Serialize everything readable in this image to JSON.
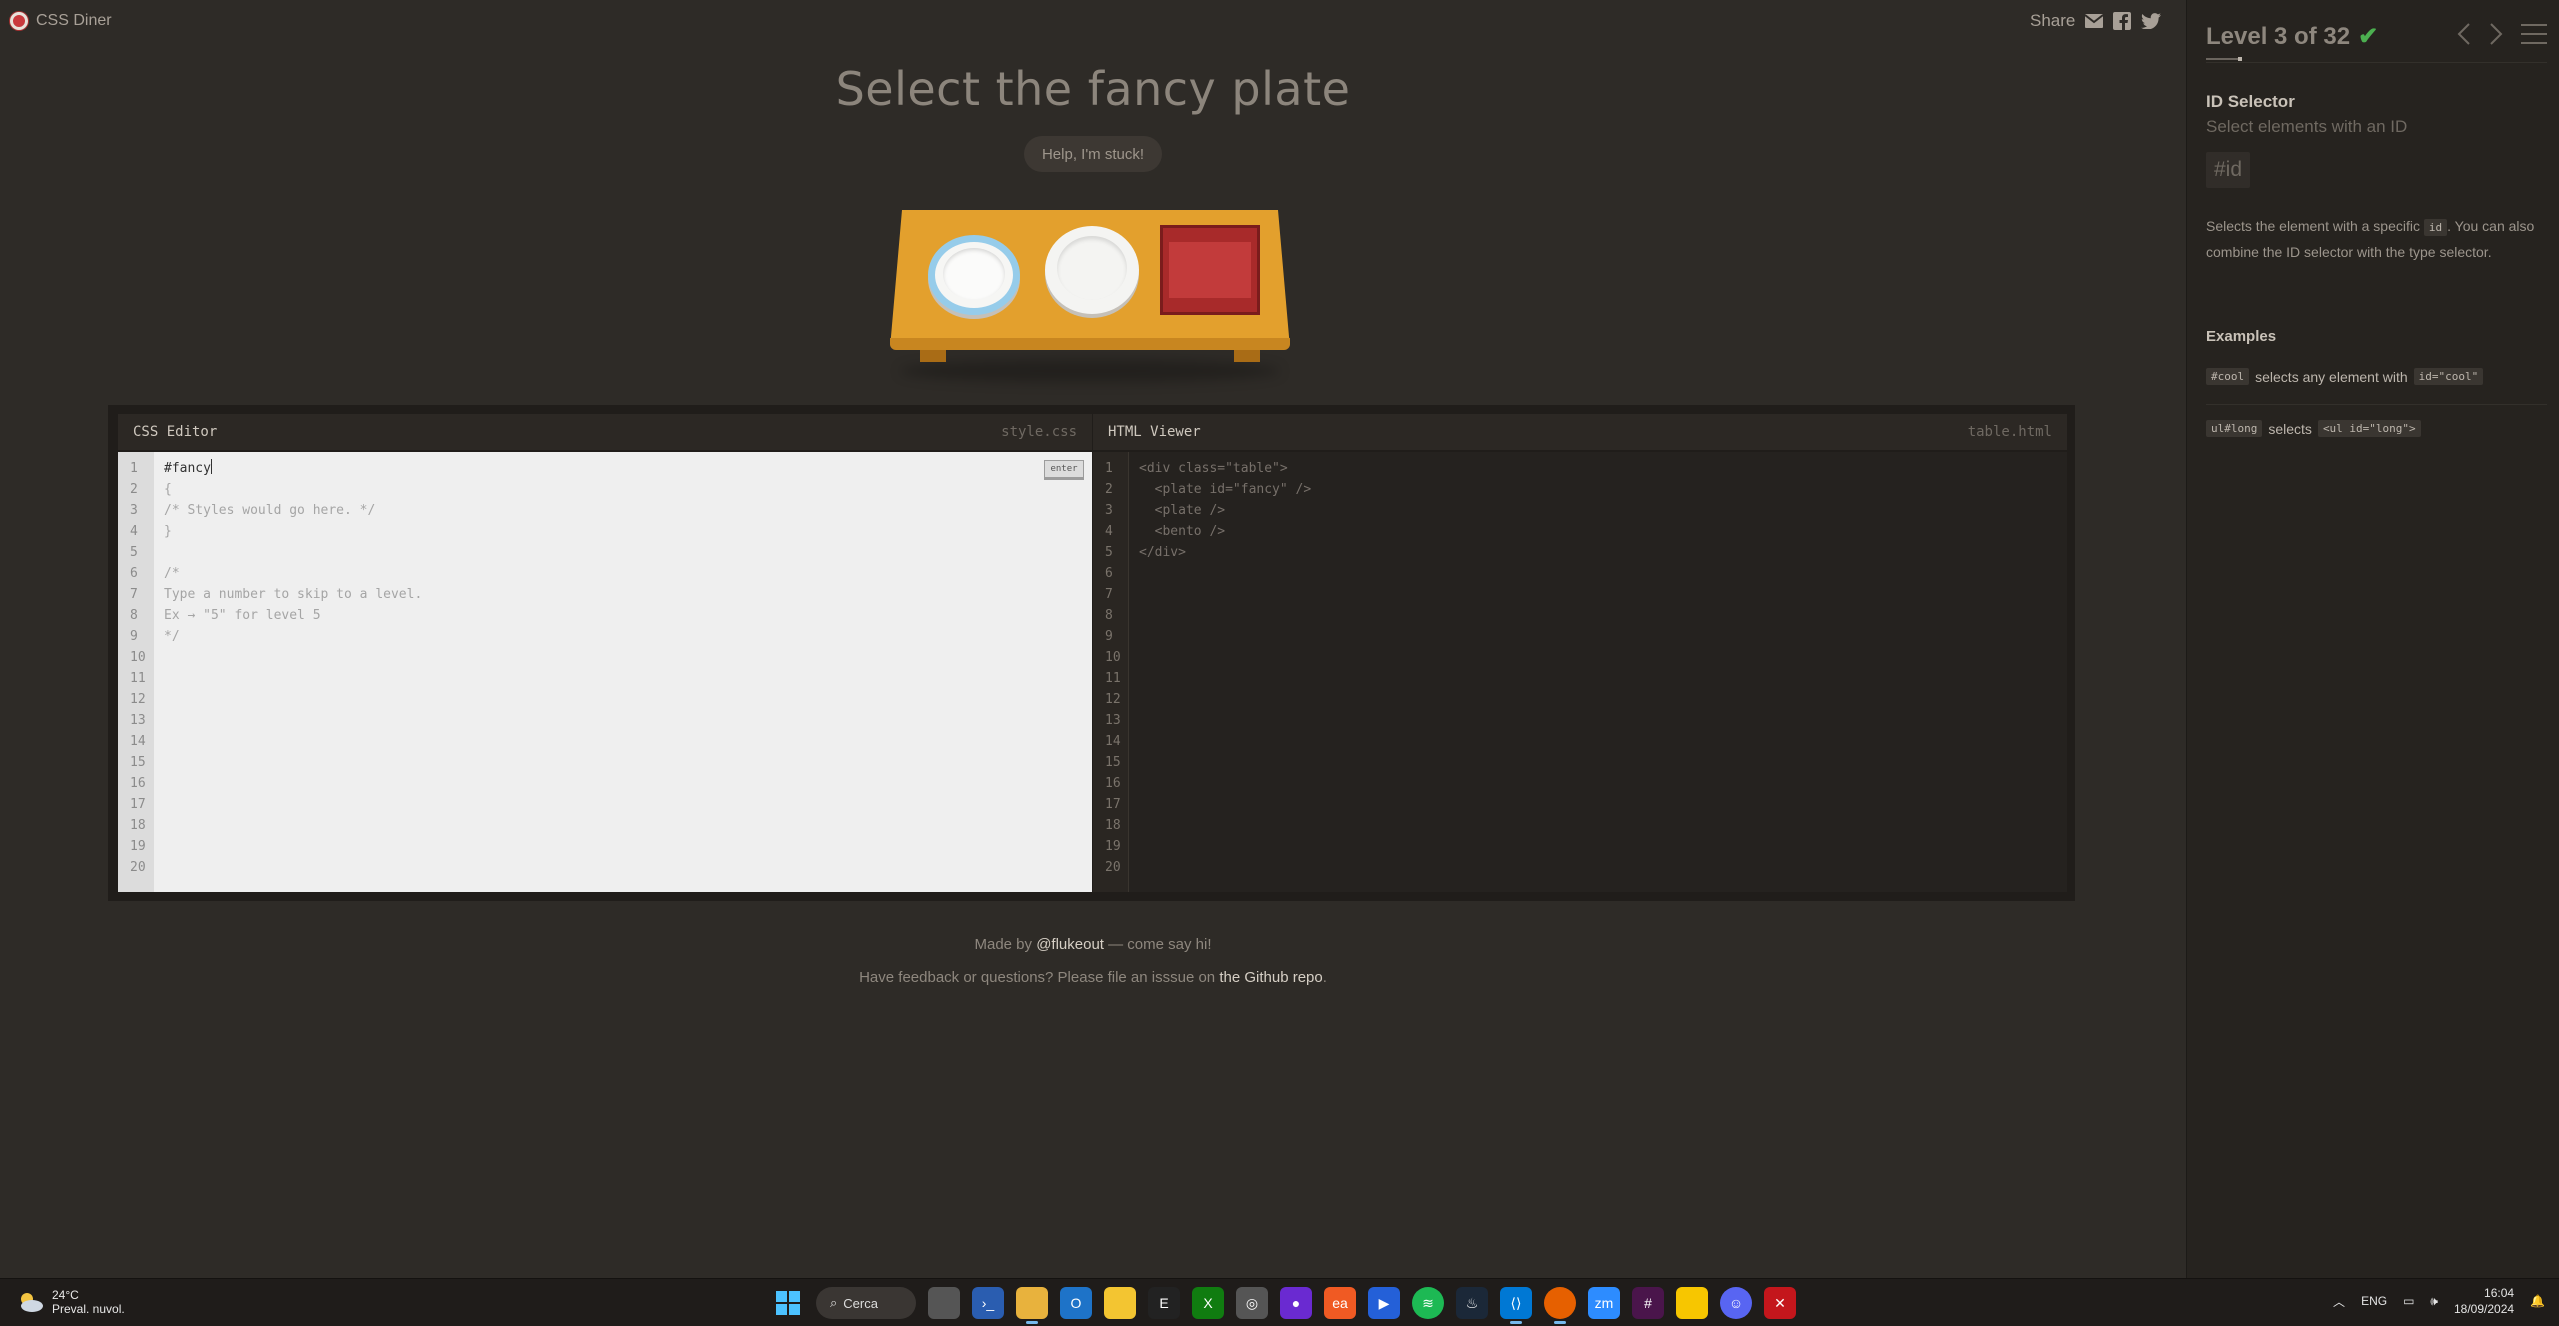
{
  "app": {
    "name": "CSS Diner"
  },
  "share": {
    "label": "Share"
  },
  "main": {
    "instruction": "Select the fancy plate",
    "help_label": "Help, I'm stuck!"
  },
  "css_editor": {
    "title": "CSS Editor",
    "file": "style.css",
    "enter_label": "enter",
    "input_value": "#fancy",
    "lines": [
      "{",
      "/* Styles would go here. */",
      "}",
      "",
      "/*",
      "Type a number to skip to a level.",
      "Ex → \"5\" for level 5",
      "*/"
    ],
    "line_numbers": [
      "1",
      "2",
      "3",
      "4",
      "5",
      "6",
      "7",
      "8",
      "9",
      "10",
      "11",
      "12",
      "13",
      "14",
      "15",
      "16",
      "17",
      "18",
      "19",
      "20"
    ]
  },
  "html_viewer": {
    "title": "HTML Viewer",
    "file": "table.html",
    "lines": [
      "<div class=\"table\">",
      "  <plate id=\"fancy\" />",
      "  <plate />",
      "  <bento />",
      "</div>"
    ],
    "line_numbers": [
      "1",
      "2",
      "3",
      "4",
      "5",
      "6",
      "7",
      "8",
      "9",
      "10",
      "11",
      "12",
      "13",
      "14",
      "15",
      "16",
      "17",
      "18",
      "19",
      "20"
    ]
  },
  "footer": {
    "made_by_prefix": "Made by",
    "made_by_link": "@flukeout",
    "made_by_suffix": "— come say hi!",
    "feedback_prefix": "Have feedback or questions? Please file an isssue on",
    "feedback_link": "the Github repo",
    "feedback_suffix": "."
  },
  "sidebar": {
    "level_label": "Level 3 of 32",
    "level_completed": true,
    "progress_fraction": 0.0625,
    "selector_name": "ID Selector",
    "selector_subtitle": "Select elements with an ID",
    "syntax": "#id",
    "desc_pre": "Selects the element with a specific",
    "desc_code": "id",
    "desc_post": ". You can also combine the ID selector with the type selector.",
    "examples_title": "Examples",
    "examples": [
      {
        "code": "#cool",
        "text": "selects any element with",
        "code2": "id=\"cool\""
      },
      {
        "code": "ul#long",
        "text": "selects",
        "code2": "<ul id=\"long\">"
      }
    ]
  },
  "taskbar": {
    "weather_temp": "24°C",
    "weather_desc": "Preval. nuvol.",
    "search_label": "Cerca",
    "language": "ENG",
    "time": "16:04",
    "date": "18/09/2024"
  },
  "colors": {
    "accent_check": "#4caf50",
    "fancy_plate_rim": "#96ccea",
    "bento": "#a82a2a",
    "table": "#e3a02d"
  }
}
